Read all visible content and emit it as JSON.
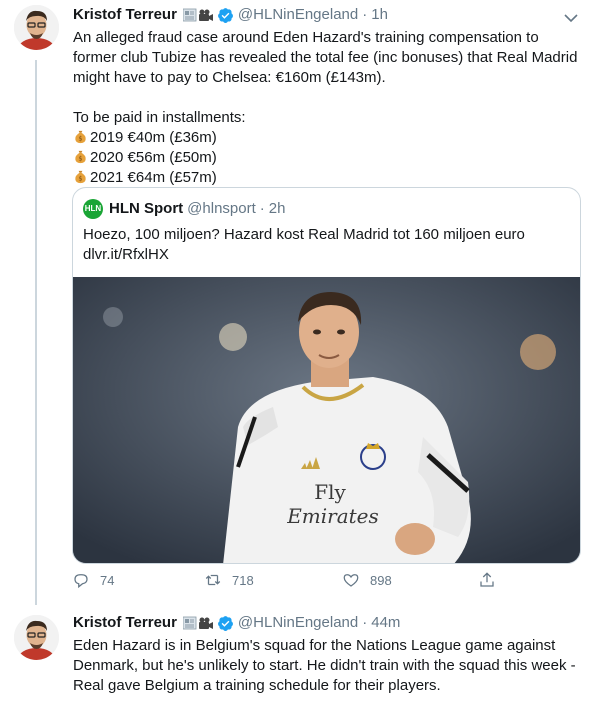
{
  "thread_tweet": {
    "author_name": "Kristof Terreur",
    "author_emoji_icons": [
      "newspaper-icon",
      "movie-camera-icon"
    ],
    "handle": "@HLNinEngeland",
    "separator": "·",
    "time": "1h",
    "text_intro": "An alleged fraud case around Eden Hazard's training compensation to former club Tubize has revealed the total fee (inc bonuses) that Real Madrid might have to pay to Chelsea: €160m (£143m).",
    "installments_heading": "To be paid in installments:",
    "installments": [
      "2019 €40m (£36m)",
      "2020 €56m (£50m)",
      "2021 €64m (£57m)"
    ],
    "quoted": {
      "logo_text": "HLN",
      "name": "HLN Sport",
      "handle": "@hlnsport",
      "separator": "·",
      "time": "2h",
      "text": "Hoezo, 100 miljoen? Hazard kost Real Madrid tot 160 miljoen euro",
      "link": "dlvr.it/RfxlHX",
      "image_jersey_text_line1": "Fly",
      "image_jersey_text_line2": "Emirates"
    },
    "actions": {
      "replies": "74",
      "retweets": "718",
      "likes": "898"
    }
  },
  "reply_tweet": {
    "author_name": "Kristof Terreur",
    "handle": "@HLNinEngeland",
    "separator": "·",
    "time": "44m",
    "text": "Eden Hazard is in Belgium's squad for the Nations League game against Denmark, but he's unlikely to start. He didn't train with the squad this week - Real gave Belgium a training schedule for their players."
  },
  "colors": {
    "text_primary": "#14171a",
    "text_secondary": "#657786",
    "border": "#ccd6dd",
    "verified_blue": "#1da1f2",
    "hln_green": "#1aa535"
  }
}
